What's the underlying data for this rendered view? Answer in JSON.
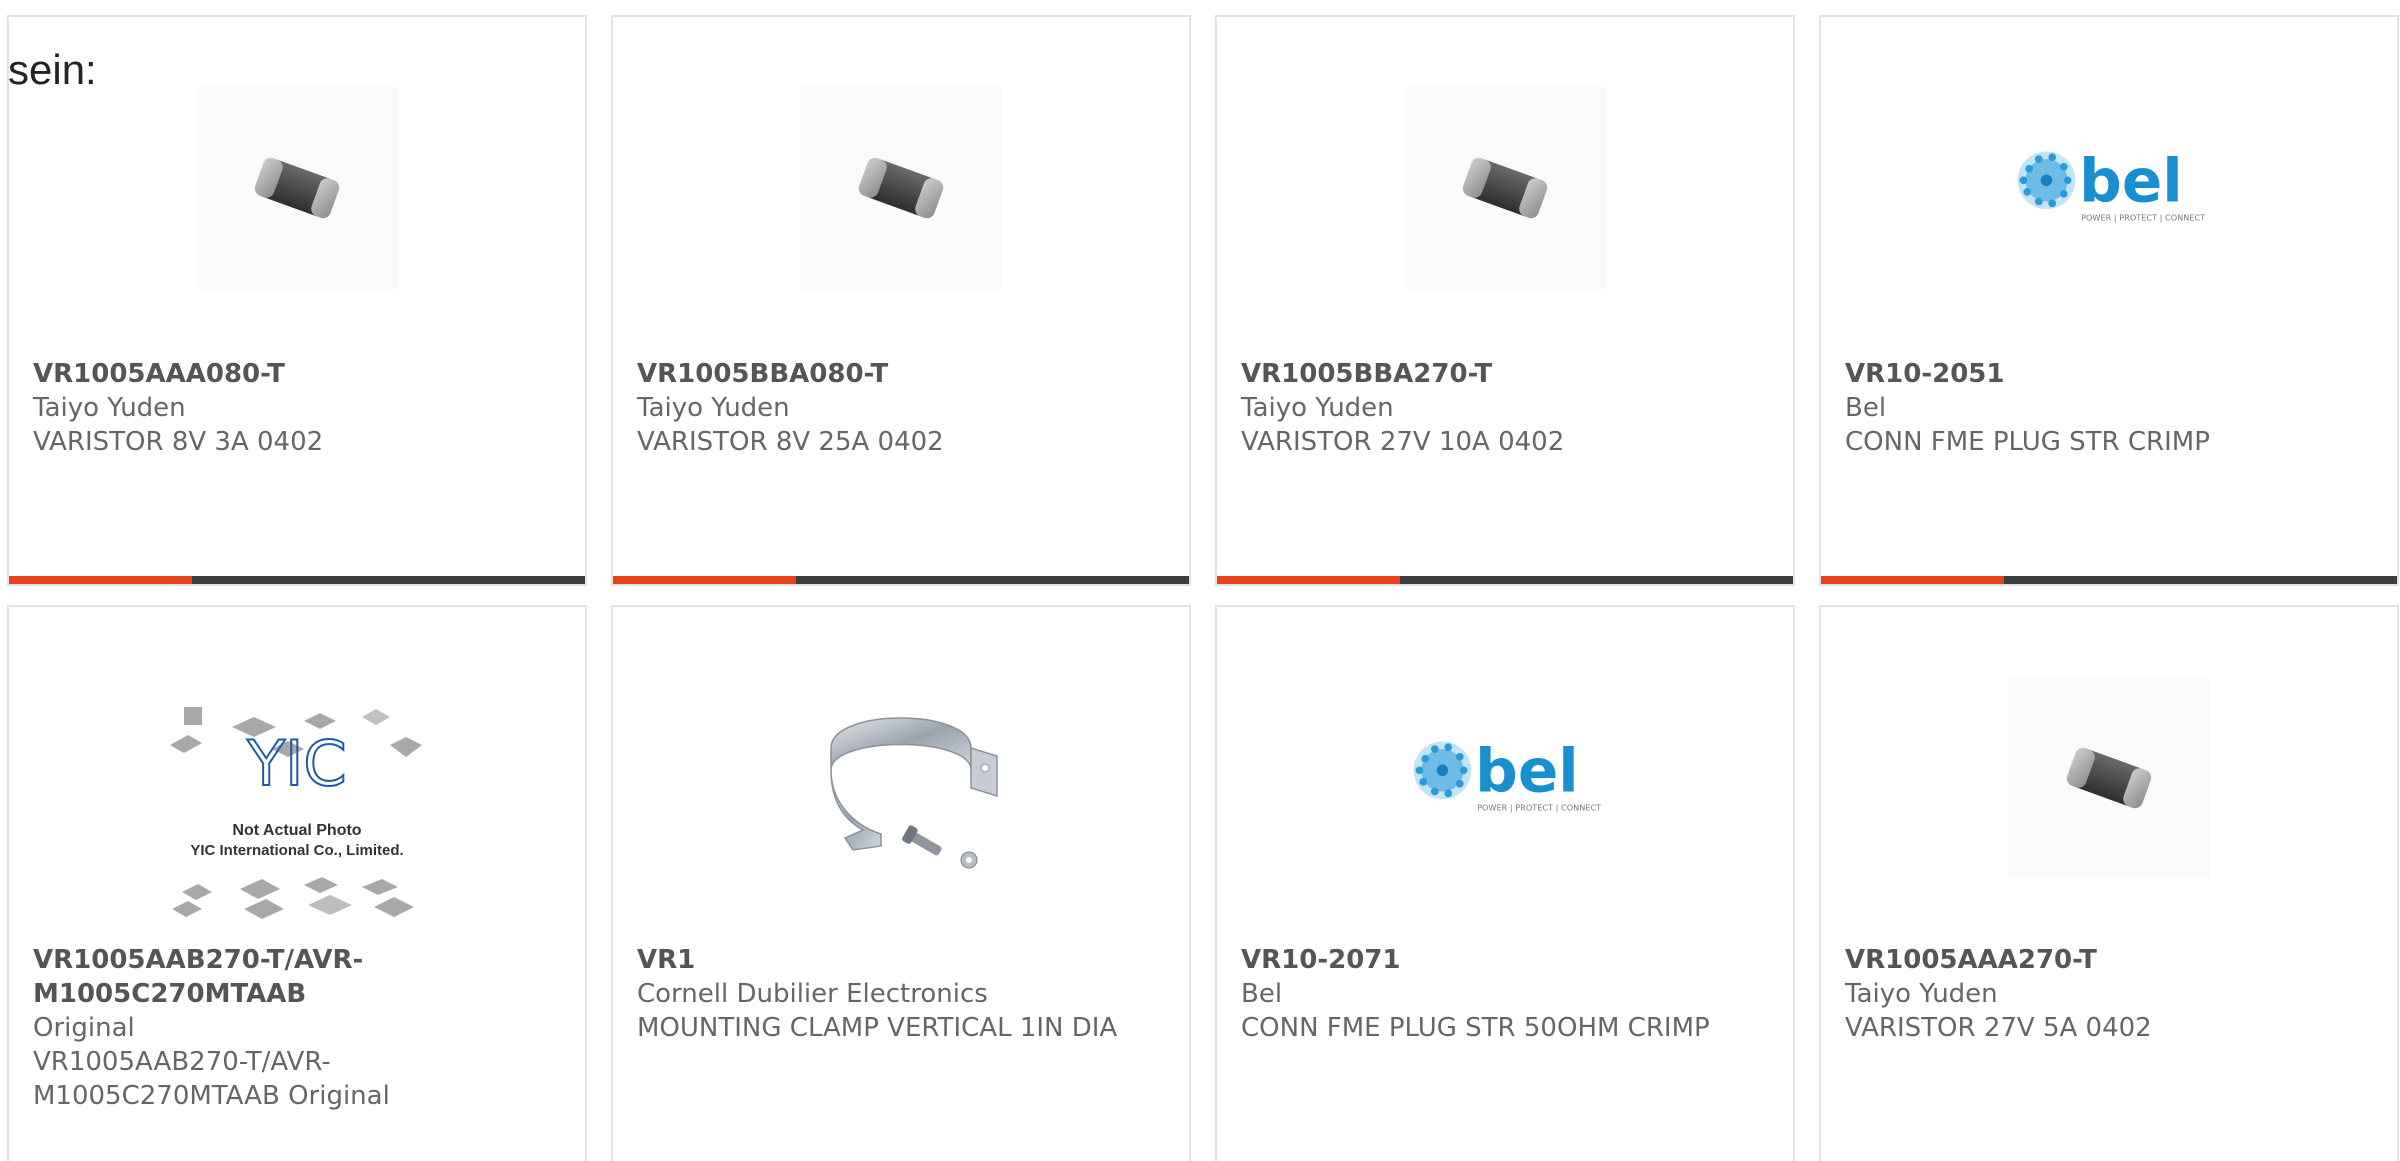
{
  "heading": "sein:",
  "colors": {
    "accent": "#e8431c",
    "bar_dark": "#3d3d3d",
    "border": "#e2e2e2"
  },
  "products": [
    {
      "part": "VR1005AAA080-T",
      "mfr": "Taiyo Yuden",
      "desc": "VARISTOR 8V 3A 0402",
      "image": "chip-component-icon"
    },
    {
      "part": "VR1005BBA080-T",
      "mfr": "Taiyo Yuden",
      "desc": "VARISTOR 8V 25A 0402",
      "image": "chip-component-icon"
    },
    {
      "part": "VR1005BBA270-T",
      "mfr": "Taiyo Yuden",
      "desc": "VARISTOR 27V 10A 0402",
      "image": "chip-component-icon"
    },
    {
      "part": "VR10-2051",
      "mfr": "Bel",
      "desc": "CONN FME PLUG STR CRIMP",
      "image": "bel-logo",
      "logo_text": "bel",
      "logo_tagline": "POWER | PROTECT | CONNECT"
    },
    {
      "part": "VR1005AAB270-T/AVR-M1005C270MTAAB",
      "mfr": "Original",
      "desc": "VR1005AAB270-T/AVR-M1005C270MTAAB Original",
      "image": "yic-placeholder",
      "logo_text": "YIC",
      "note1": "Not Actual Photo",
      "note2": "YIC International Co., Limited."
    },
    {
      "part": "VR1",
      "mfr": "Cornell Dubilier Electronics",
      "desc": "MOUNTING CLAMP VERTICAL 1IN DIA",
      "image": "mounting-clamp-icon"
    },
    {
      "part": "VR10-2071",
      "mfr": "Bel",
      "desc": "CONN FME PLUG STR 50OHM CRIMP",
      "image": "bel-logo",
      "logo_text": "bel",
      "logo_tagline": "POWER | PROTECT | CONNECT"
    },
    {
      "part": "VR1005AAA270-T",
      "mfr": "Taiyo Yuden",
      "desc": "VARISTOR 27V 5A 0402",
      "image": "chip-component-icon"
    }
  ]
}
